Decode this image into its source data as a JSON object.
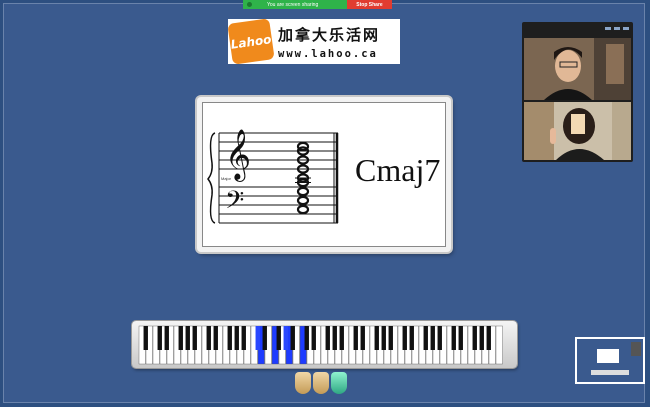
{
  "share_bar": {
    "status_text": "You are screen sharing",
    "stop_label": "Stop Share",
    "status_color": "#2fb34a",
    "stop_color": "#e13c30"
  },
  "logo": {
    "brand": "Lahoo",
    "chinese_name": "加拿大乐活网",
    "url": "www.lahoo.ca"
  },
  "chord_card": {
    "chord_name": "Cmaj7",
    "staff_label": "Major",
    "treble_notes": [
      "C5",
      "B4",
      "G4",
      "E4",
      "C4"
    ],
    "bass_notes": [
      "G3",
      "E3",
      "C3"
    ]
  },
  "piano": {
    "highlighted_keys": [
      "C",
      "E",
      "G",
      "B"
    ],
    "highlight_color": "#1e3cff"
  },
  "videos": {
    "participant_count": 2
  }
}
